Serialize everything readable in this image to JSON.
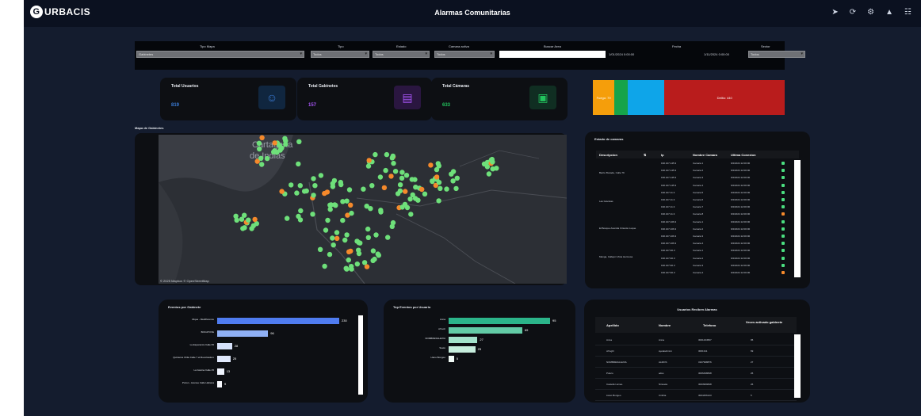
{
  "header": {
    "title": "Alarmas Comunitarias",
    "logo_text": "URBACIS",
    "menu_icon": "hamburger-icon",
    "icons": [
      "send-icon",
      "refresh-icon",
      "settings-icon",
      "bell-icon",
      "users-icon"
    ]
  },
  "filters": {
    "tipo_mapa": {
      "label": "Tipo Mapa",
      "value": "Gabinetes"
    },
    "tipo": {
      "label": "Tipo",
      "value": "Todos"
    },
    "estado": {
      "label": "Estado",
      "value": "Todos"
    },
    "camara_activa": {
      "label": "Camara activa",
      "value": "Todos"
    },
    "buscar_area": {
      "label": "Buscar Area",
      "value": ""
    },
    "fecha": {
      "label": "Fecha",
      "start": "1/01/2024 0:00:00",
      "end": "1/11/2024 0:00:00"
    },
    "sector": {
      "label": "Sector",
      "value": "Todos"
    }
  },
  "kpis": [
    {
      "label": "Total Usuarios",
      "value": "819",
      "color": "#3a7bd5",
      "icon": "users-icon"
    },
    {
      "label": "Total Gabinetes",
      "value": "157",
      "color": "#a855f7",
      "icon": "cabinet-icon"
    },
    {
      "label": "Total Cámaras",
      "value": "633",
      "color": "#22c55e",
      "icon": "camera-icon"
    }
  ],
  "status_bar": {
    "segments": [
      {
        "label": "Fuego: 79",
        "value": 79,
        "color": "#f59e0b"
      },
      {
        "label": "",
        "value": 50,
        "color": "#16a34a"
      },
      {
        "label": "",
        "value": 133,
        "color": "#0ea5e9"
      },
      {
        "label": "Delito: 440",
        "value": 440,
        "color": "#b91c1c"
      }
    ]
  },
  "map": {
    "title": "Mapa de Gabinetes",
    "city_label": "Cartagena de Indias",
    "attribution": "© 2025 Mapbox  © OpenStreetMap",
    "green": "#6ee07a",
    "orange": "#f5892b"
  },
  "camera_table": {
    "title": "Estado de camaras",
    "columns": [
      "Descripcion",
      "Ip",
      "Nombre Camara",
      "Ultima Conexion"
    ],
    "groups": [
      "Barrio Bocade, Calle 79",
      "Las Gaviotas",
      "El Bosque Avenida Crisanto Luque",
      "Manga, Callejon Vista Hermosa"
    ],
    "rows": [
      {
        "ip": "190.107.145.3",
        "name": "Camara 1",
        "last": "6/2/2024 12:00:00",
        "status": "green"
      },
      {
        "ip": "190.107.145.3",
        "name": "Camara 2",
        "last": "6/2/2024 12:00:00",
        "status": "green"
      },
      {
        "ip": "190.107.145.3",
        "name": "Camara 3",
        "last": "6/2/2024 12:00:00",
        "status": "green"
      },
      {
        "ip": "190.107.145.3",
        "name": "Camara 4",
        "last": "6/2/2024 12:00:00",
        "status": "green"
      },
      {
        "ip": "190.107.11.3",
        "name": "Camara 5",
        "last": "6/2/2024 12:00:00",
        "status": "green"
      },
      {
        "ip": "190.107.11.3",
        "name": "Camara 6",
        "last": "6/2/2024 12:00:00",
        "status": "green"
      },
      {
        "ip": "190.107.11.3",
        "name": "Camara 7",
        "last": "6/2/2024 12:00:00",
        "status": "green"
      },
      {
        "ip": "190.107.11.3",
        "name": "Camara 8",
        "last": "6/2/2024 12:00:00",
        "status": "orange"
      },
      {
        "ip": "190.107.106.3",
        "name": "Camara 1",
        "last": "6/2/2024 12:00:00",
        "status": "green"
      },
      {
        "ip": "190.107.106.3",
        "name": "Camara 2",
        "last": "6/2/2024 12:00:00",
        "status": "green"
      },
      {
        "ip": "190.107.106.3",
        "name": "Camara 3",
        "last": "6/2/2024 12:00:00",
        "status": "green"
      },
      {
        "ip": "190.107.106.3",
        "name": "Camara 4",
        "last": "6/2/2024 12:00:00",
        "status": "green"
      },
      {
        "ip": "190.107.90.3",
        "name": "Camara 1",
        "last": "6/2/2024 12:00:00",
        "status": "green"
      },
      {
        "ip": "190.107.90.3",
        "name": "Camara 2",
        "last": "6/2/2024 12:00:00",
        "status": "green"
      },
      {
        "ip": "190.107.90.3",
        "name": "Camara 3",
        "last": "6/2/2024 12:00:00",
        "status": "green"
      },
      {
        "ip": "190.107.90.3",
        "name": "Camara 4",
        "last": "6/2/2024 12:00:00",
        "status": "orange"
      }
    ]
  },
  "eventos_gabinete": {
    "title": "Eventos por Gabinete",
    "categories": [
      "Rique - Mediflorence",
      "BOCATOVE",
      "La Esperanza Calle 65",
      "Quinteros Chile Calle 7 el Revolcadero",
      "La Gavina Calle 45",
      "Pozon - Avenue Calle Habana"
    ],
    "values": [
      230,
      96,
      28,
      25,
      13,
      9
    ],
    "colors": [
      "#4f7cf0",
      "#8fb0f5",
      "#d6e2fb",
      "#e0e9fc",
      "#eef3fd",
      "#f7f9fe"
    ]
  },
  "eventos_usuario": {
    "title": "Top Eventos por Usuario",
    "categories": [
      "Anna",
      "crhsoh",
      "NOMBRESALEXIA",
      "Suelo",
      "Llano Bongeo"
    ],
    "values": [
      95,
      69,
      27,
      25,
      5
    ],
    "colors": [
      "#2bb58a",
      "#62cba6",
      "#a3e2cb",
      "#c6eddd",
      "#f1faf6"
    ]
  },
  "users_table": {
    "title": "Usuarios Reciben Alarmas",
    "columns": [
      "Apellido",
      "Nombre",
      "Telefono",
      "Veces activado gabinete"
    ],
    "rows": [
      [
        "Anna",
        "Anna",
        "3001234567",
        "95"
      ],
      [
        "crhsghr",
        "ayelasdnnnn",
        "3001311",
        "69"
      ],
      [
        "NOMBRESALEXIA",
        "ALMOS",
        "3107998876",
        "27"
      ],
      [
        "Pulero",
        "adus",
        "3006498848",
        "26"
      ],
      [
        "Castellor arnao",
        "Nirsuela",
        "3003969848",
        "26"
      ],
      [
        "Llano Bongeo",
        "Cinthia",
        "3004456123",
        "5"
      ]
    ]
  }
}
